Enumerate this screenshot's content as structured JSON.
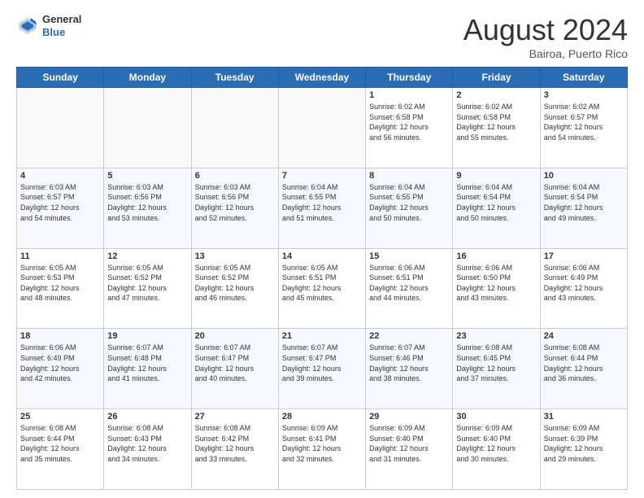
{
  "header": {
    "logo_general": "General",
    "logo_blue": "Blue",
    "month_title": "August 2024",
    "location": "Bairoa, Puerto Rico"
  },
  "days_of_week": [
    "Sunday",
    "Monday",
    "Tuesday",
    "Wednesday",
    "Thursday",
    "Friday",
    "Saturday"
  ],
  "weeks": [
    [
      {
        "day": "",
        "info": ""
      },
      {
        "day": "",
        "info": ""
      },
      {
        "day": "",
        "info": ""
      },
      {
        "day": "",
        "info": ""
      },
      {
        "day": "1",
        "info": "Sunrise: 6:02 AM\nSunset: 6:58 PM\nDaylight: 12 hours\nand 56 minutes."
      },
      {
        "day": "2",
        "info": "Sunrise: 6:02 AM\nSunset: 6:58 PM\nDaylight: 12 hours\nand 55 minutes."
      },
      {
        "day": "3",
        "info": "Sunrise: 6:02 AM\nSunset: 6:57 PM\nDaylight: 12 hours\nand 54 minutes."
      }
    ],
    [
      {
        "day": "4",
        "info": "Sunrise: 6:03 AM\nSunset: 6:57 PM\nDaylight: 12 hours\nand 54 minutes."
      },
      {
        "day": "5",
        "info": "Sunrise: 6:03 AM\nSunset: 6:56 PM\nDaylight: 12 hours\nand 53 minutes."
      },
      {
        "day": "6",
        "info": "Sunrise: 6:03 AM\nSunset: 6:56 PM\nDaylight: 12 hours\nand 52 minutes."
      },
      {
        "day": "7",
        "info": "Sunrise: 6:04 AM\nSunset: 6:55 PM\nDaylight: 12 hours\nand 51 minutes."
      },
      {
        "day": "8",
        "info": "Sunrise: 6:04 AM\nSunset: 6:55 PM\nDaylight: 12 hours\nand 50 minutes."
      },
      {
        "day": "9",
        "info": "Sunrise: 6:04 AM\nSunset: 6:54 PM\nDaylight: 12 hours\nand 50 minutes."
      },
      {
        "day": "10",
        "info": "Sunrise: 6:04 AM\nSunset: 6:54 PM\nDaylight: 12 hours\nand 49 minutes."
      }
    ],
    [
      {
        "day": "11",
        "info": "Sunrise: 6:05 AM\nSunset: 6:53 PM\nDaylight: 12 hours\nand 48 minutes."
      },
      {
        "day": "12",
        "info": "Sunrise: 6:05 AM\nSunset: 6:52 PM\nDaylight: 12 hours\nand 47 minutes."
      },
      {
        "day": "13",
        "info": "Sunrise: 6:05 AM\nSunset: 6:52 PM\nDaylight: 12 hours\nand 46 minutes."
      },
      {
        "day": "14",
        "info": "Sunrise: 6:05 AM\nSunset: 6:51 PM\nDaylight: 12 hours\nand 45 minutes."
      },
      {
        "day": "15",
        "info": "Sunrise: 6:06 AM\nSunset: 6:51 PM\nDaylight: 12 hours\nand 44 minutes."
      },
      {
        "day": "16",
        "info": "Sunrise: 6:06 AM\nSunset: 6:50 PM\nDaylight: 12 hours\nand 43 minutes."
      },
      {
        "day": "17",
        "info": "Sunrise: 6:06 AM\nSunset: 6:49 PM\nDaylight: 12 hours\nand 43 minutes."
      }
    ],
    [
      {
        "day": "18",
        "info": "Sunrise: 6:06 AM\nSunset: 6:49 PM\nDaylight: 12 hours\nand 42 minutes."
      },
      {
        "day": "19",
        "info": "Sunrise: 6:07 AM\nSunset: 6:48 PM\nDaylight: 12 hours\nand 41 minutes."
      },
      {
        "day": "20",
        "info": "Sunrise: 6:07 AM\nSunset: 6:47 PM\nDaylight: 12 hours\nand 40 minutes."
      },
      {
        "day": "21",
        "info": "Sunrise: 6:07 AM\nSunset: 6:47 PM\nDaylight: 12 hours\nand 39 minutes."
      },
      {
        "day": "22",
        "info": "Sunrise: 6:07 AM\nSunset: 6:46 PM\nDaylight: 12 hours\nand 38 minutes."
      },
      {
        "day": "23",
        "info": "Sunrise: 6:08 AM\nSunset: 6:45 PM\nDaylight: 12 hours\nand 37 minutes."
      },
      {
        "day": "24",
        "info": "Sunrise: 6:08 AM\nSunset: 6:44 PM\nDaylight: 12 hours\nand 36 minutes."
      }
    ],
    [
      {
        "day": "25",
        "info": "Sunrise: 6:08 AM\nSunset: 6:44 PM\nDaylight: 12 hours\nand 35 minutes."
      },
      {
        "day": "26",
        "info": "Sunrise: 6:08 AM\nSunset: 6:43 PM\nDaylight: 12 hours\nand 34 minutes."
      },
      {
        "day": "27",
        "info": "Sunrise: 6:08 AM\nSunset: 6:42 PM\nDaylight: 12 hours\nand 33 minutes."
      },
      {
        "day": "28",
        "info": "Sunrise: 6:09 AM\nSunset: 6:41 PM\nDaylight: 12 hours\nand 32 minutes."
      },
      {
        "day": "29",
        "info": "Sunrise: 6:09 AM\nSunset: 6:40 PM\nDaylight: 12 hours\nand 31 minutes."
      },
      {
        "day": "30",
        "info": "Sunrise: 6:09 AM\nSunset: 6:40 PM\nDaylight: 12 hours\nand 30 minutes."
      },
      {
        "day": "31",
        "info": "Sunrise: 6:09 AM\nSunset: 6:39 PM\nDaylight: 12 hours\nand 29 minutes."
      }
    ]
  ]
}
